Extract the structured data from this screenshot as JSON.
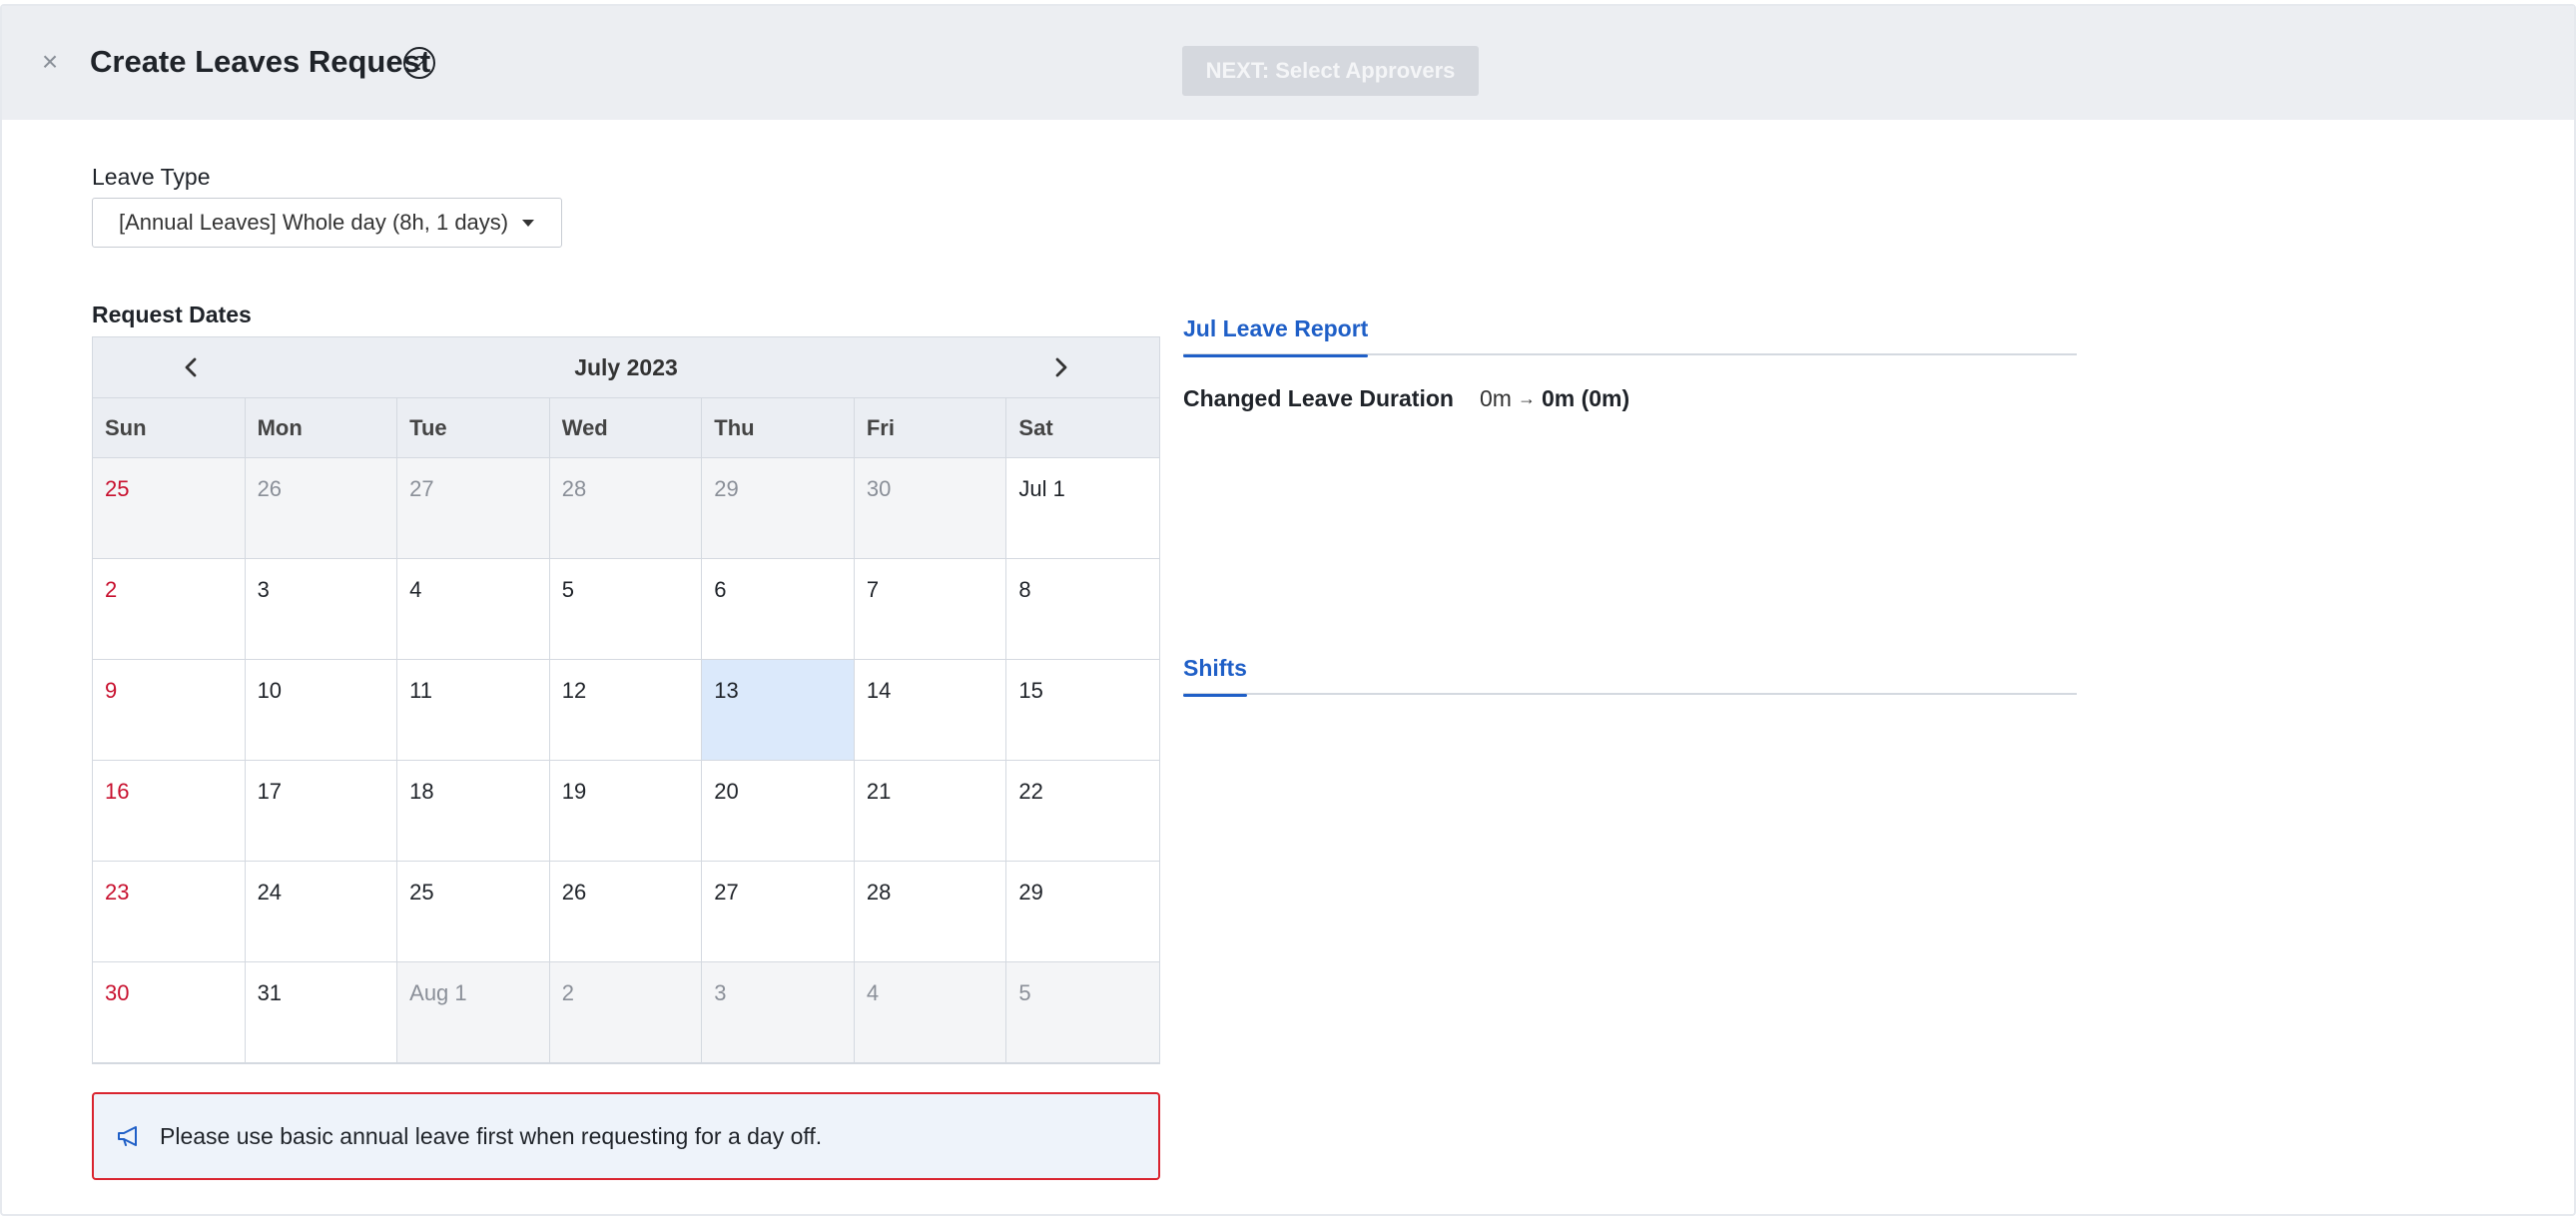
{
  "header": {
    "title": "Create Leaves Request",
    "next_button": "NEXT: Select Approvers"
  },
  "leave_type": {
    "label": "Leave Type",
    "selected": "[Annual Leaves] Whole day (8h, 1 days)"
  },
  "request_dates": {
    "label": "Request Dates",
    "month": "July 2023",
    "weekdays": [
      "Sun",
      "Mon",
      "Tue",
      "Wed",
      "Thu",
      "Fri",
      "Sat"
    ],
    "days": [
      {
        "label": "25",
        "other": true,
        "sun": true
      },
      {
        "label": "26",
        "other": true
      },
      {
        "label": "27",
        "other": true
      },
      {
        "label": "28",
        "other": true
      },
      {
        "label": "29",
        "other": true
      },
      {
        "label": "30",
        "other": true
      },
      {
        "label": "Jul 1"
      },
      {
        "label": "2",
        "sun": true
      },
      {
        "label": "3"
      },
      {
        "label": "4"
      },
      {
        "label": "5"
      },
      {
        "label": "6"
      },
      {
        "label": "7"
      },
      {
        "label": "8"
      },
      {
        "label": "9",
        "sun": true
      },
      {
        "label": "10"
      },
      {
        "label": "11"
      },
      {
        "label": "12"
      },
      {
        "label": "13",
        "selected": true
      },
      {
        "label": "14"
      },
      {
        "label": "15"
      },
      {
        "label": "16",
        "sun": true
      },
      {
        "label": "17"
      },
      {
        "label": "18"
      },
      {
        "label": "19"
      },
      {
        "label": "20"
      },
      {
        "label": "21"
      },
      {
        "label": "22"
      },
      {
        "label": "23",
        "sun": true
      },
      {
        "label": "24"
      },
      {
        "label": "25"
      },
      {
        "label": "26"
      },
      {
        "label": "27"
      },
      {
        "label": "28"
      },
      {
        "label": "29"
      },
      {
        "label": "30",
        "sun": true
      },
      {
        "label": "31"
      },
      {
        "label": "Aug 1",
        "other": true
      },
      {
        "label": "2",
        "other": true
      },
      {
        "label": "3",
        "other": true
      },
      {
        "label": "4",
        "other": true
      },
      {
        "label": "5",
        "other": true
      }
    ]
  },
  "notice": {
    "text": "Please use basic annual leave first when requesting for a day off."
  },
  "leave_report": {
    "tab_label": "Jul Leave Report",
    "duration_label": "Changed Leave Duration",
    "duration_from": "0m",
    "duration_arrow": "→",
    "duration_to": "0m (0m)"
  },
  "shifts": {
    "tab_label": "Shifts"
  },
  "colors": {
    "accent": "#1f5fc7",
    "sunday": "#c8102e",
    "notice_border": "#d9232e",
    "selected_day": "#dbe9fb"
  }
}
